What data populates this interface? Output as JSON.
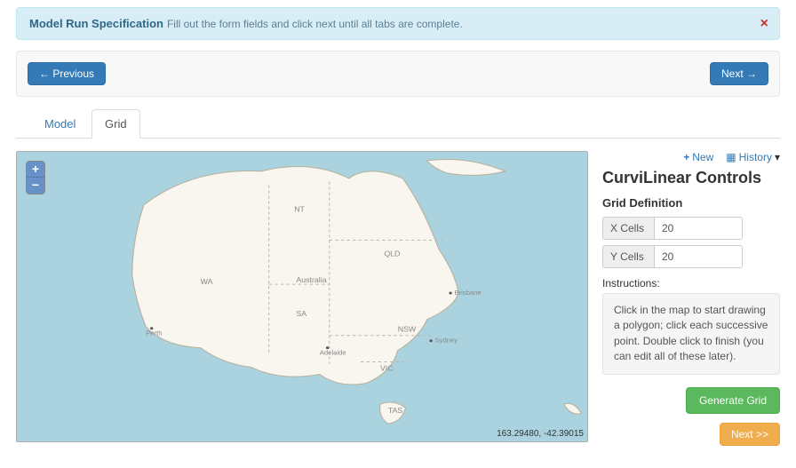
{
  "alert": {
    "title": "Model Run Specification",
    "message": "Fill out the form fields and click next until all tabs are complete.",
    "close": "×"
  },
  "nav": {
    "previous": "← Previous",
    "next": "Next →"
  },
  "tabs": {
    "model": "Model",
    "grid": "Grid"
  },
  "map": {
    "zoom_in": "+",
    "zoom_out": "−",
    "coords": "163.29480, -42.39015",
    "labels": {
      "WA": "WA",
      "NT": "NT",
      "QLD": "QLD",
      "SA": "SA",
      "NSW": "NSW",
      "VIC": "VIC",
      "TAS": "TAS",
      "Australia": "Australia",
      "Perth": "Perth",
      "Adelaide": "Adelaide",
      "Brisbane": "Brisbane",
      "Sydney": "Sydney"
    }
  },
  "side": {
    "new": "New",
    "history": "History",
    "title": "CurviLinear Controls",
    "grid_def": "Grid Definition",
    "x_cells_label": "X Cells",
    "x_cells_value": "20",
    "y_cells_label": "Y Cells",
    "y_cells_value": "20",
    "instructions_label": "Instructions:",
    "instructions": "Click in the map to start drawing a polygon; click each successive point. Double click to finish (you can edit all of these later).",
    "generate": "Generate Grid",
    "next": "Next >>"
  },
  "icons": {
    "plus": "+",
    "grid": "▦",
    "caret": "▾"
  }
}
